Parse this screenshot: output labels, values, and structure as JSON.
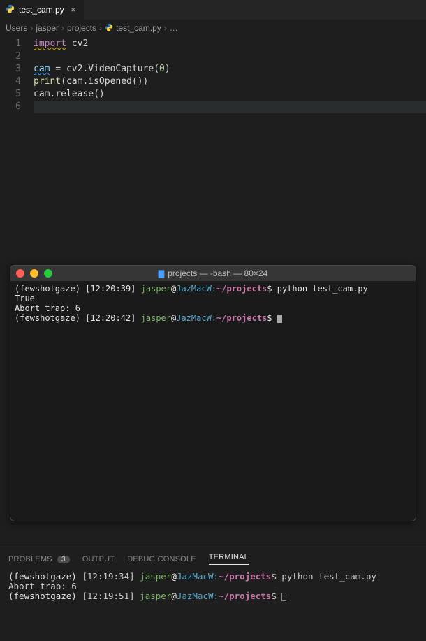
{
  "tab": {
    "filename": "test_cam.py"
  },
  "breadcrumb": {
    "parts": [
      "Users",
      "jasper",
      "projects"
    ],
    "file": "test_cam.py",
    "tail": "…"
  },
  "editor": {
    "lines": [
      {
        "n": "1",
        "html": "<span class='kw wavy-y'>import</span><span class='plain'> cv2</span>"
      },
      {
        "n": "2",
        "html": ""
      },
      {
        "n": "3",
        "html": "<span class='var wavy-b'>cam</span><span class='plain'> = cv2.VideoCapture(</span><span class='num'>0</span><span class='plain'>)</span>"
      },
      {
        "n": "4",
        "html": "<span class='fn'>print</span><span class='plain'>(cam.isOpened())</span>"
      },
      {
        "n": "5",
        "html": "<span class='plain'>cam.release()</span>"
      },
      {
        "n": "6",
        "html": ""
      }
    ]
  },
  "mac_terminal": {
    "title": "projects — -bash — 80×24",
    "lines": [
      {
        "type": "prompt",
        "env": "(fewshotgaze)",
        "time": "[12:20:39]",
        "user": "jasper",
        "host": "JazMacW:",
        "path": "~/projects",
        "cmd": "python test_cam.py"
      },
      {
        "type": "out",
        "text": "True"
      },
      {
        "type": "out",
        "text": "Abort trap: 6"
      },
      {
        "type": "prompt",
        "env": "(fewshotgaze)",
        "time": "[12:20:42]",
        "user": "jasper",
        "host": "JazMacW:",
        "path": "~/projects",
        "cmd": "",
        "cursor": true
      }
    ]
  },
  "panel": {
    "tabs": {
      "problems": "PROBLEMS",
      "problems_badge": "3",
      "output": "OUTPUT",
      "debug": "DEBUG CONSOLE",
      "terminal": "TERMINAL"
    },
    "terminal_lines": [
      {
        "type": "prompt",
        "env": "(fewshotgaze)",
        "time": "[12:19:34]",
        "user": "jasper",
        "host": "JazMacW:",
        "path": "~/projects",
        "cmd": "python test_cam.py"
      },
      {
        "type": "out",
        "text": "Abort trap: 6"
      },
      {
        "type": "prompt",
        "env": "(fewshotgaze)",
        "time": "[12:19:51]",
        "user": "jasper",
        "host": "JazMacW:",
        "path": "~/projects",
        "cmd": "",
        "cursor": true
      }
    ]
  }
}
